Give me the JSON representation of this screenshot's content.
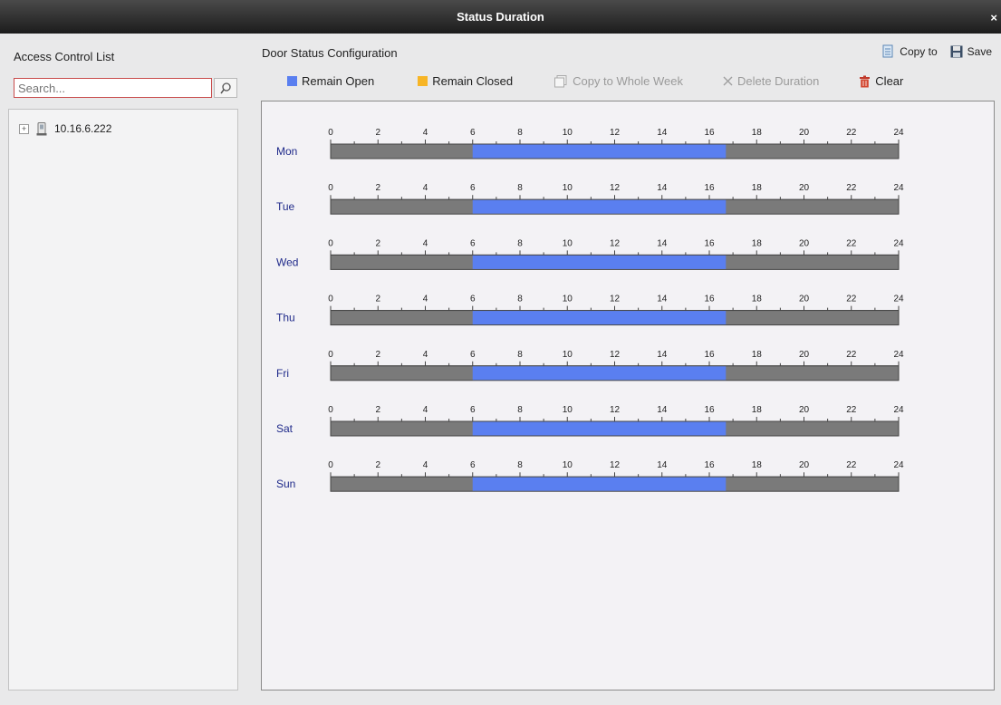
{
  "window": {
    "title": "Status Duration",
    "close_label": "×"
  },
  "left": {
    "title": "Access Control List",
    "search": {
      "value": "",
      "placeholder": "Search..."
    },
    "tree": [
      {
        "label": "10.16.6.222"
      }
    ]
  },
  "config": {
    "title": "Door Status Configuration",
    "copy_to_label": "Copy to",
    "save_label": "Save",
    "remain_open_label": "Remain Open",
    "remain_closed_label": "Remain Closed",
    "copy_whole_week_label": "Copy to Whole Week",
    "delete_duration_label": "Delete Duration",
    "clear_label": "Clear"
  },
  "colors": {
    "remain_open": "#5a7ff0",
    "remain_closed": "#f7b526",
    "track": "#7a7a7a",
    "day_label": "#1f2a8a"
  },
  "schedule": {
    "hour_ticks": [
      "0",
      "2",
      "4",
      "6",
      "8",
      "10",
      "12",
      "14",
      "16",
      "18",
      "20",
      "22",
      "24"
    ],
    "days": [
      {
        "name": "Mon",
        "segments": [
          {
            "start": 6,
            "end": 16.7,
            "status": "Remain Open"
          }
        ]
      },
      {
        "name": "Tue",
        "segments": [
          {
            "start": 6,
            "end": 16.7,
            "status": "Remain Open"
          }
        ]
      },
      {
        "name": "Wed",
        "segments": [
          {
            "start": 6,
            "end": 16.7,
            "status": "Remain Open"
          }
        ]
      },
      {
        "name": "Thu",
        "segments": [
          {
            "start": 6,
            "end": 16.7,
            "status": "Remain Open"
          }
        ]
      },
      {
        "name": "Fri",
        "segments": [
          {
            "start": 6,
            "end": 16.7,
            "status": "Remain Open"
          }
        ]
      },
      {
        "name": "Sat",
        "segments": [
          {
            "start": 6,
            "end": 16.7,
            "status": "Remain Open"
          }
        ]
      },
      {
        "name": "Sun",
        "segments": [
          {
            "start": 6,
            "end": 16.7,
            "status": "Remain Open"
          }
        ]
      }
    ]
  }
}
